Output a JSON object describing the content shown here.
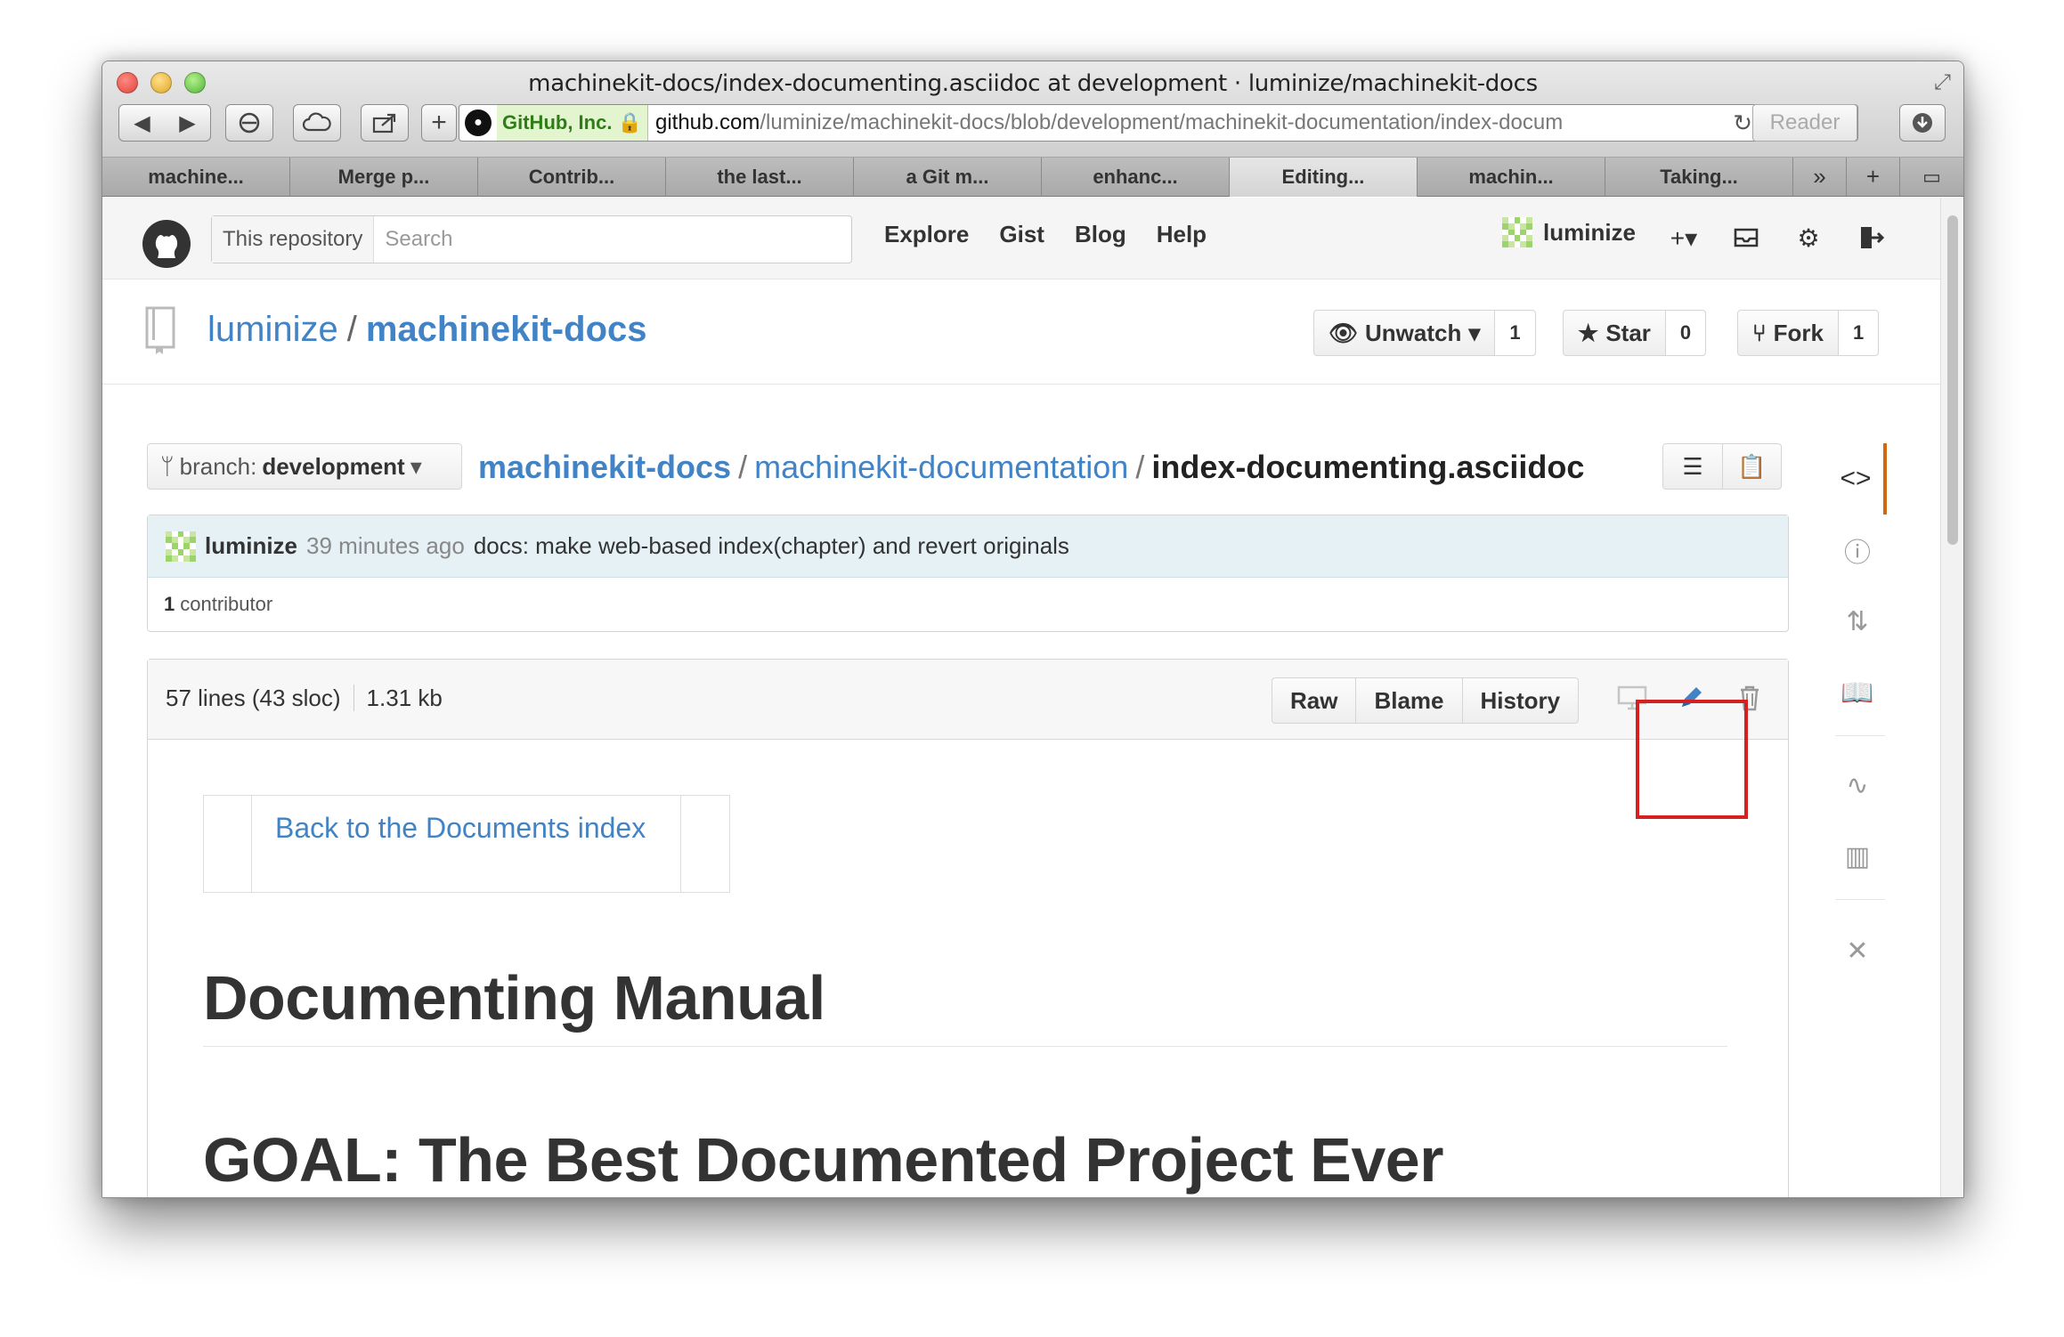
{
  "window": {
    "title": "machinekit-docs/index-documenting.asciidoc at development · luminize/machinekit-docs"
  },
  "toolbar": {
    "url_cert": "GitHub, Inc.",
    "url_host": "github.com",
    "url_path": "/luminize/machinekit-docs/blob/development/machinekit-documentation/index-docum",
    "reader_label": "Reader"
  },
  "tabs": [
    {
      "label": "machine..."
    },
    {
      "label": "Merge p..."
    },
    {
      "label": "Contrib..."
    },
    {
      "label": "the last..."
    },
    {
      "label": "a Git m..."
    },
    {
      "label": "enhanc..."
    },
    {
      "label": "Editing..."
    },
    {
      "label": "machin..."
    },
    {
      "label": "Taking..."
    }
  ],
  "gh_header": {
    "search_scope": "This repository",
    "search_placeholder": "Search",
    "nav": [
      "Explore",
      "Gist",
      "Blog",
      "Help"
    ],
    "username": "luminize"
  },
  "repo": {
    "owner": "luminize",
    "name": "machinekit-docs",
    "watch_label": "Unwatch",
    "watch_count": "1",
    "star_label": "Star",
    "star_count": "0",
    "fork_label": "Fork",
    "fork_count": "1"
  },
  "file_nav": {
    "branch_prefix": "branch:",
    "branch": "development",
    "crumb_root": "machinekit-docs",
    "crumb_dir": "machinekit-documentation",
    "crumb_file": "index-documenting.asciidoc"
  },
  "commit": {
    "author": "luminize",
    "time": "39 minutes ago",
    "message": "docs: make web-based index(chapter) and revert originals",
    "contributors_count": "1",
    "contributors_label": "contributor"
  },
  "file": {
    "lines": "57 lines (43 sloc)",
    "size": "1.31 kb",
    "raw_label": "Raw",
    "blame_label": "Blame",
    "history_label": "History"
  },
  "content": {
    "back_link": "Back to the Documents index",
    "h1": "Documenting Manual",
    "h2": "GOAL: The Best Documented Project Ever"
  },
  "colors": {
    "link": "#4183c4",
    "highlight": "#d42021",
    "commit_bg": "#e6f1f6",
    "active_side": "#d26911"
  }
}
